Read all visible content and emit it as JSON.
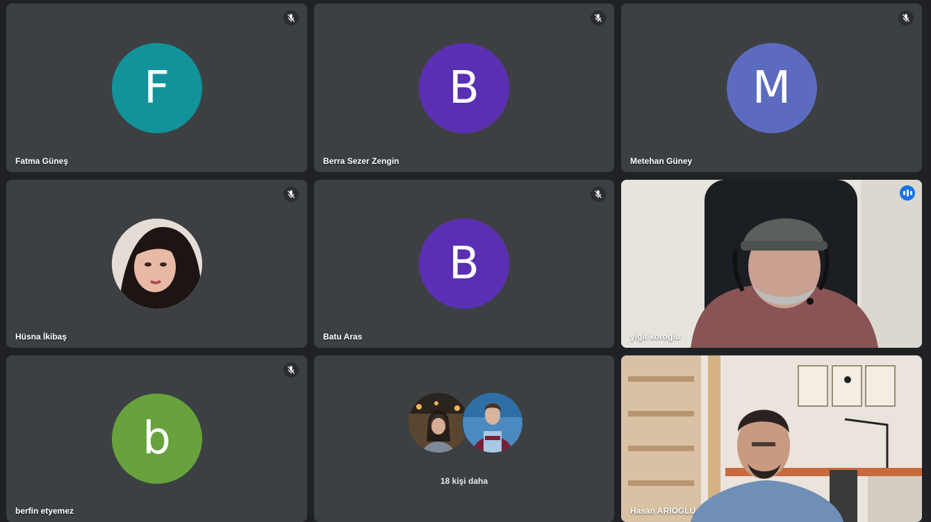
{
  "participants": [
    {
      "name": "Fatma Güneş",
      "initial": "F",
      "color": "#12939a",
      "muted": true
    },
    {
      "name": "Berra Sezer Zengin",
      "initial": "B",
      "color": "#5b2fb4",
      "muted": true
    },
    {
      "name": "Metehan Güney",
      "initial": "M",
      "color": "#5c6bc0",
      "muted": true
    },
    {
      "name": "Hüsna İkibaş",
      "initial": "",
      "color": "#7a6a66",
      "muted": true
    },
    {
      "name": "Batu Aras",
      "initial": "B",
      "color": "#5b2fb4",
      "muted": true
    },
    {
      "name": "yigit koroglu",
      "initial": "",
      "color": "",
      "muted": false,
      "speaking": true
    },
    {
      "name": "berfin etyemez",
      "initial": "b",
      "color": "#67a23c",
      "muted": true
    },
    {
      "name": "Hasan ARIOGLU",
      "initial": "",
      "color": "",
      "muted": false
    }
  ],
  "more": {
    "label": "18 kişi daha"
  },
  "icons": {
    "muted": "mic-off-icon",
    "speaking": "audio-level-icon"
  },
  "colors": {
    "background": "#202124",
    "tile": "#3c4043",
    "active_border": "#8ab4f8",
    "speaking_badge": "#1a73e8"
  }
}
